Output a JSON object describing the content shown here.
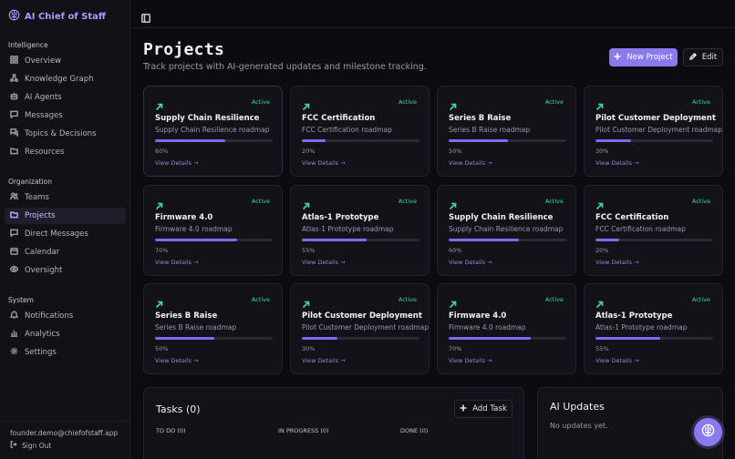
{
  "app": {
    "name": "AI Chief of Staff"
  },
  "sidebar": {
    "sections": [
      {
        "label": "Intelligence",
        "items": [
          "Overview",
          "Knowledge Graph",
          "AI Agents",
          "Messages",
          "Topics & Decisions",
          "Resources"
        ]
      },
      {
        "label": "Organization",
        "items": [
          "Teams",
          "Projects",
          "Direct Messages",
          "Calendar",
          "Oversight"
        ]
      },
      {
        "label": "System",
        "items": [
          "Notifications",
          "Analytics",
          "Settings"
        ]
      }
    ],
    "active": "Projects",
    "user_email": "founder.demo@chiefofstaff.app",
    "signout_label": "Sign Out"
  },
  "header": {
    "title": "Projects",
    "subtitle": "Track projects with AI-generated updates and milestone tracking.",
    "new_project_label": "New Project",
    "edit_label": "Edit"
  },
  "projects": [
    {
      "title": "Supply Chain Resilience",
      "subtitle": "Supply Chain Resilience roadmap",
      "status": "Active",
      "progress": 60,
      "progress_label": "60%",
      "details": "View Details →"
    },
    {
      "title": "FCC Certification",
      "subtitle": "FCC Certification roadmap",
      "status": "Active",
      "progress": 20,
      "progress_label": "20%",
      "details": "View Details →"
    },
    {
      "title": "Series B Raise",
      "subtitle": "Series B Raise roadmap",
      "status": "Active",
      "progress": 50,
      "progress_label": "50%",
      "details": "View Details →"
    },
    {
      "title": "Pilot Customer Deployment",
      "subtitle": "Pilot Customer Deployment roadmap",
      "status": "Active",
      "progress": 30,
      "progress_label": "30%",
      "details": "View Details →"
    },
    {
      "title": "Firmware 4.0",
      "subtitle": "Firmware 4.0 roadmap",
      "status": "Active",
      "progress": 70,
      "progress_label": "70%",
      "details": "View Details →"
    },
    {
      "title": "Atlas-1 Prototype",
      "subtitle": "Atlas-1 Prototype roadmap",
      "status": "Active",
      "progress": 55,
      "progress_label": "55%",
      "details": "View Details →"
    },
    {
      "title": "Supply Chain Resilience",
      "subtitle": "Supply Chain Resilience roadmap",
      "status": "Active",
      "progress": 60,
      "progress_label": "60%",
      "details": "View Details →"
    },
    {
      "title": "FCC Certification",
      "subtitle": "FCC Certification roadmap",
      "status": "Active",
      "progress": 20,
      "progress_label": "20%",
      "details": "View Details →"
    },
    {
      "title": "Series B Raise",
      "subtitle": "Series B Raise roadmap",
      "status": "Active",
      "progress": 50,
      "progress_label": "50%",
      "details": "View Details →"
    },
    {
      "title": "Pilot Customer Deployment",
      "subtitle": "Pilot Customer Deployment roadmap",
      "status": "Active",
      "progress": 30,
      "progress_label": "30%",
      "details": "View Details →"
    },
    {
      "title": "Firmware 4.0",
      "subtitle": "Firmware 4.0 roadmap",
      "status": "Active",
      "progress": 70,
      "progress_label": "70%",
      "details": "View Details →"
    },
    {
      "title": "Atlas-1 Prototype",
      "subtitle": "Atlas-1 Prototype roadmap",
      "status": "Active",
      "progress": 55,
      "progress_label": "55%",
      "details": "View Details →"
    }
  ],
  "tasks": {
    "title": "Tasks (0)",
    "add_label": "Add Task",
    "columns": [
      "TO DO (0)",
      "IN PROGRESS (0)",
      "DONE (0)"
    ]
  },
  "ai_updates": {
    "title": "AI Updates",
    "empty": "No updates yet."
  },
  "colors": {
    "accent": "#8a7af0",
    "status": "#3fd6a8",
    "progress": "#7c6cf0"
  }
}
